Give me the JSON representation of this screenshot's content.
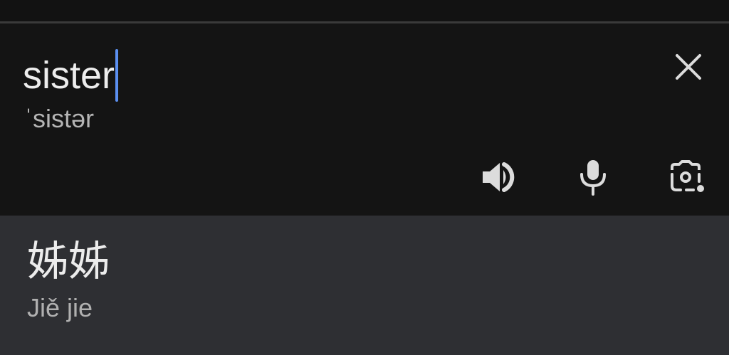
{
  "source": {
    "text": "sister",
    "phonetic": "ˈsistər"
  },
  "actions": {
    "clear_icon": "close-icon",
    "speaker_icon": "speaker-icon",
    "mic_icon": "microphone-icon",
    "camera_icon": "camera-icon"
  },
  "result": {
    "translation": "姊姊",
    "romanization": "Jiě jie"
  },
  "colors": {
    "background": "#141414",
    "result_background": "#2e2f33",
    "caret": "#5b8ff0",
    "text": "#ededed",
    "secondary_text": "#b5b5b5",
    "icon": "#dcdcdc"
  }
}
